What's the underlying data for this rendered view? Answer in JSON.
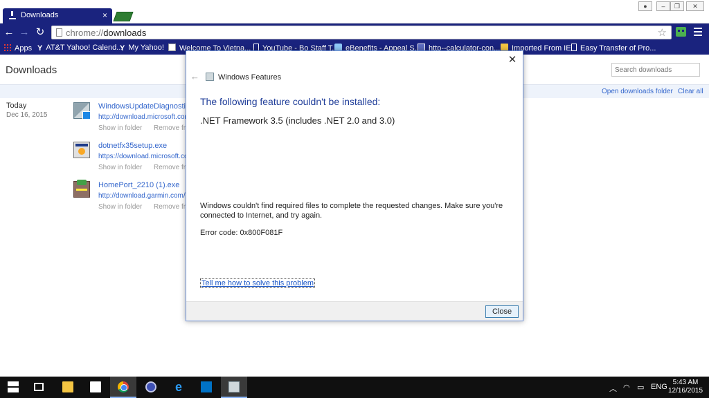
{
  "browser": {
    "tab_title": "Downloads",
    "url_scheme": "chrome://",
    "url_path": "downloads",
    "bookmarks": [
      {
        "label": "Apps",
        "icon": "apps-grid-icon"
      },
      {
        "label": "AT&T Yahoo! Calend...",
        "icon": "yahoo-icon"
      },
      {
        "label": "My Yahoo!",
        "icon": "yahoo-icon"
      },
      {
        "label": "Welcome To Vietna...",
        "icon": "site-image-icon"
      },
      {
        "label": "YouTube - Bo Staff T...",
        "icon": "page-icon"
      },
      {
        "label": "eBenefits - Appeal S...",
        "icon": "ebenefits-icon"
      },
      {
        "label": "http--calculator-con...",
        "icon": "calculator-icon"
      },
      {
        "label": "Imported From IE",
        "icon": "folder-icon"
      },
      {
        "label": "Easy Transfer of Pro...",
        "icon": "page-icon"
      }
    ]
  },
  "downloads": {
    "title": "Downloads",
    "search_placeholder": "Search downloads",
    "open_folder": "Open downloads folder",
    "clear_all": "Clear all",
    "date_label": "Today",
    "date_value": "Dec 16, 2015",
    "items": [
      {
        "name": "WindowsUpdateDiagnostic.diagcab",
        "url": "http://download.microsoft.com",
        "show": "Show in folder",
        "remove": "Remove from list"
      },
      {
        "name": "dotnetfx35setup.exe",
        "url": "https://download.microsoft.com",
        "show": "Show in folder",
        "remove": "Remove from list"
      },
      {
        "name": "HomePort_2210 (1).exe",
        "url": "http://download.garmin.com/",
        "show": "Show in folder",
        "remove": "Remove from list"
      }
    ]
  },
  "dialog": {
    "window_title": "Windows Features",
    "heading": "The following feature couldn't be installed:",
    "feature": ".NET Framework 3.5 (includes .NET 2.0 and 3.0)",
    "message": "Windows couldn't find required files to complete the requested changes. Make sure you're connected to Internet, and try again.",
    "error_code": "Error code: 0x800F081F",
    "help_link": "Tell me how to solve this problem",
    "close_button": "Close"
  },
  "taskbar": {
    "language": "ENG",
    "time": "5:43 AM",
    "date": "12/16/2015"
  },
  "colors": {
    "chrome_theme": "#1a237e",
    "link": "#3366cc",
    "dialog_heading": "#1f3d99"
  }
}
